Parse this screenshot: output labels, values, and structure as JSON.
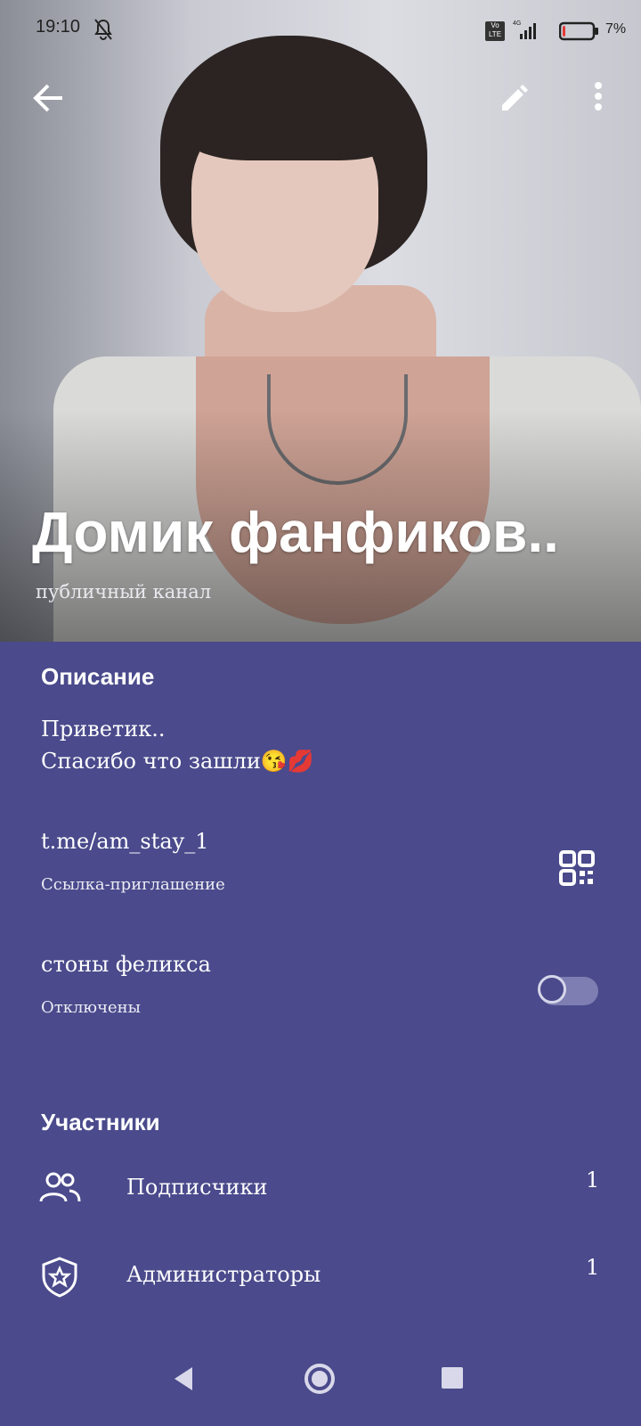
{
  "status_bar": {
    "time": "19:10",
    "network_badge": "Vo LTE",
    "network_type": "4G",
    "battery_percent": "7%",
    "battery_level": 0.07,
    "icons": [
      "bell-off-icon",
      "volte-icon",
      "signal-icon",
      "battery-icon"
    ]
  },
  "header": {
    "title": "Домик фанфиков..",
    "subtitle": "публичный канал",
    "actions": [
      "back-arrow-icon",
      "edit-pencil-icon",
      "more-vert-icon"
    ]
  },
  "description": {
    "section_title": "Описание",
    "line1": "Приветик..",
    "line2": "Спасибо что зашли",
    "emojis": "😘💋"
  },
  "link": {
    "value": "t.me/am_stay_1",
    "caption": "Ссылка-приглашение",
    "icon": "qr-code-icon"
  },
  "notifications": {
    "title": "стоны феликса",
    "status": "Отключены",
    "enabled": false
  },
  "members": {
    "section_title": "Участники",
    "rows": [
      {
        "label": "Подписчики",
        "count": "1",
        "icon": "people-icon"
      },
      {
        "label": "Администраторы",
        "count": "1",
        "icon": "shield-star-icon"
      }
    ]
  },
  "colors": {
    "background": "#4a4a8c",
    "text": "#ffffff",
    "toggle_track": "#7e7eb2",
    "battery_low": "#e53935"
  },
  "navbar": [
    "nav-back-icon",
    "nav-home-icon",
    "nav-recents-icon"
  ]
}
